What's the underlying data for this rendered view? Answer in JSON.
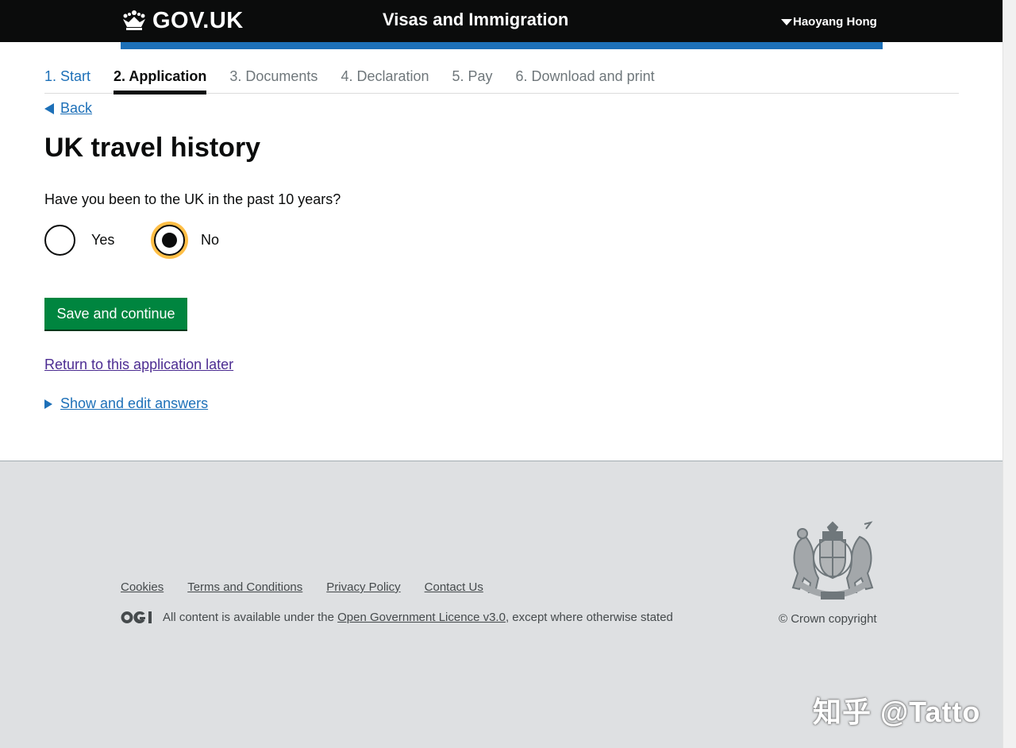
{
  "header": {
    "logo_text": "GOV.UK",
    "service_name": "Visas and Immigration",
    "user_name": "Haoyang Hong"
  },
  "steps": [
    {
      "label": "1. Start",
      "state": "done"
    },
    {
      "label": "2. Application",
      "state": "active"
    },
    {
      "label": "3. Documents",
      "state": "todo"
    },
    {
      "label": "4. Declaration",
      "state": "todo"
    },
    {
      "label": "5. Pay",
      "state": "todo"
    },
    {
      "label": "6. Download and print",
      "state": "todo"
    }
  ],
  "main": {
    "back_label": "Back",
    "title": "UK travel history",
    "question": "Have you been to the UK in the past 10 years?",
    "options": [
      {
        "label": "Yes",
        "selected": false
      },
      {
        "label": "No",
        "selected": true
      }
    ],
    "submit_label": "Save and continue",
    "return_link": "Return to this application later",
    "details_label": "Show and edit answers"
  },
  "footer": {
    "links": [
      "Cookies",
      "Terms and Conditions",
      "Privacy Policy",
      "Contact Us"
    ],
    "licence_prefix": "All content is available under the ",
    "licence_link": "Open Government Licence v3.0",
    "licence_suffix": ", except where otherwise stated",
    "copyright": "© Crown copyright"
  },
  "watermark": "知乎 @Tatto",
  "colors": {
    "header_bg": "#0b0c0c",
    "accent_blue": "#1d70b8",
    "button_green": "#00853f",
    "focus_yellow": "#ffbf47",
    "footer_bg": "#dee0e2"
  }
}
